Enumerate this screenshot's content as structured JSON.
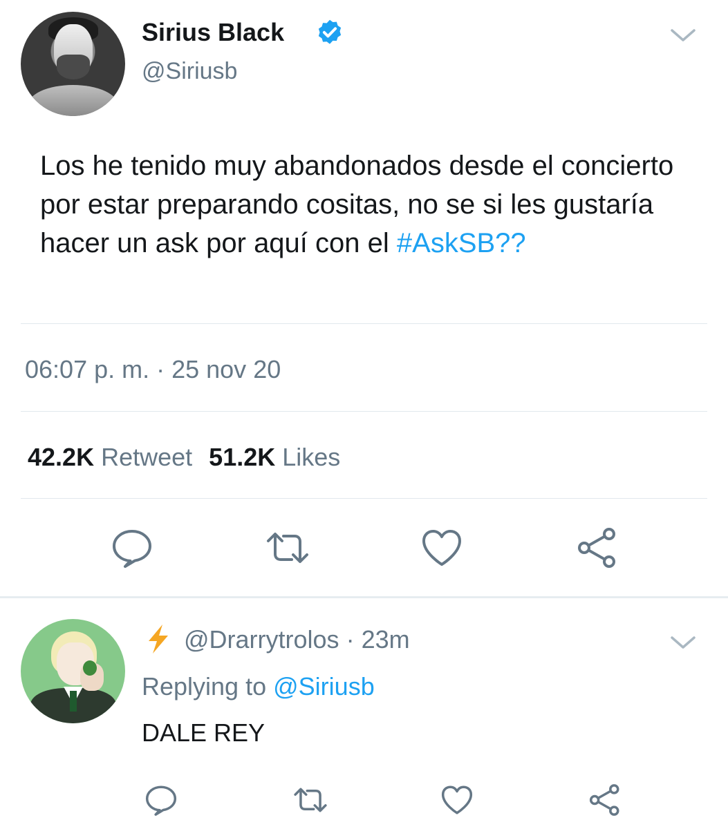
{
  "tweet": {
    "author": {
      "name": "Sirius Black",
      "handle": "@Siriusb",
      "verified": true,
      "avatar_icon": "profile-photo"
    },
    "text_parts": {
      "plain": "Los he tenido muy abandonados desde el concierto por estar preparando cositas, no se si les gustaría hacer un ask por aquí con el ",
      "hashtag": "#AskSB??"
    },
    "timestamp": "06:07 p. m. · 25 nov 20",
    "stats": {
      "retweets_count": "42.2K",
      "retweets_label": "Retweet",
      "likes_count": "51.2K",
      "likes_label": "Likes"
    },
    "actions": [
      "reply-icon",
      "retweet-icon",
      "like-icon",
      "share-icon"
    ]
  },
  "reply": {
    "handle": "@Drarrytrolos",
    "time": "· 23m",
    "replying_label": "Replying to",
    "replying_to": "@Siriusb",
    "text": "DALE REY",
    "actions": [
      "reply-icon",
      "retweet-icon",
      "like-icon",
      "share-icon"
    ]
  },
  "colors": {
    "accent": "#1da1f2",
    "text_primary": "#14171a",
    "text_secondary": "#657786",
    "divider": "#e1e8ed",
    "icon": "#657786",
    "bolt": "#f5a623"
  }
}
